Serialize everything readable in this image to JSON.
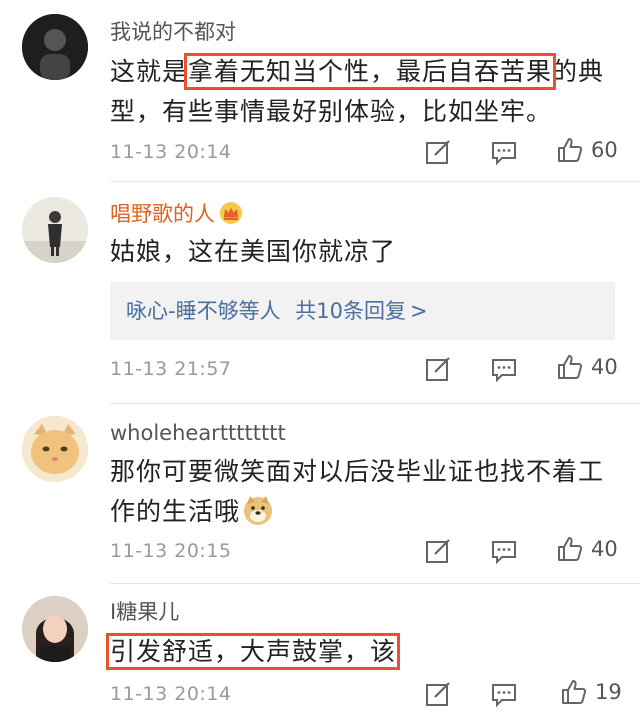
{
  "comments": [
    {
      "username": "我说的不都对",
      "text_before": "这就是",
      "text_highlight": "拿着无知当个性，最后自吞苦果",
      "text_after": "的典型，有些事情最好别体验，比如坐牢。",
      "time": "11-13 20:14",
      "likes": "60"
    },
    {
      "username": "唱野歌的人",
      "text": "姑娘，这在美国你就凉了",
      "reply_from": "咏心-睡不够等人",
      "reply_count": "共10条回复",
      "reply_arrow": ">",
      "time": "11-13 21:57",
      "likes": "40"
    },
    {
      "username": "wholeheartttttttt",
      "text": "那你可要微笑面对以后没毕业证也找不着工作的生活哦",
      "time": "11-13 20:15",
      "likes": "40"
    },
    {
      "username": "I糖果儿",
      "text_highlight": "引发舒适，大声鼓掌，该",
      "time": "11-13 20:14",
      "likes": "19"
    }
  ],
  "icons": {
    "repost": "edit-square-icon",
    "comment": "comment-bubble-icon",
    "like": "thumbs-up-icon",
    "vip_badge": "crown-badge-icon",
    "emoji": "doge-emoji"
  },
  "colors": {
    "highlight_box": "#e8502e",
    "vip_name": "#e0621f",
    "reply_link": "#4a6e9e",
    "meta": "#9a9a9a"
  }
}
